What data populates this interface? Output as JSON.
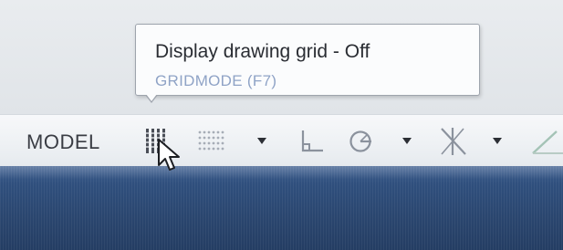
{
  "tooltip": {
    "title": "Display drawing grid - Off",
    "subtitle": "GRIDMODE (F7)"
  },
  "statusbar": {
    "model_label": "MODEL",
    "tools": [
      {
        "icon": "grid-display-icon"
      },
      {
        "icon": "snap-mode-icon"
      },
      {
        "icon": "snap-dropdown-arrow-icon"
      },
      {
        "icon": "ortho-mode-icon"
      },
      {
        "icon": "polar-tracking-icon"
      },
      {
        "icon": "polar-dropdown-arrow-icon"
      },
      {
        "icon": "isodraft-icon"
      },
      {
        "icon": "isodraft-dropdown-arrow-icon"
      },
      {
        "icon": "object-snap-tracking-icon"
      }
    ]
  },
  "colors": {
    "tooltip_subtitle": "#8fa3c6",
    "taskbar": "#2f4f7d",
    "statusbar": "#eef1f4"
  }
}
